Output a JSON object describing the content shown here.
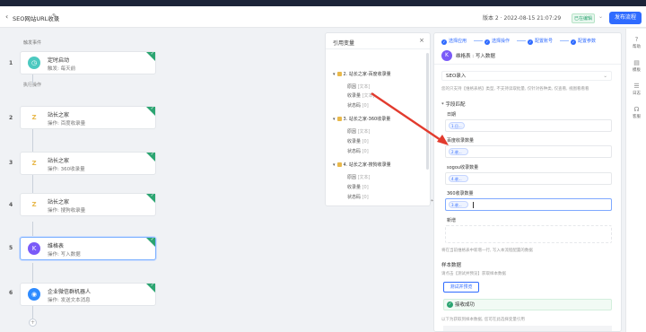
{
  "header": {
    "back_icon": "chevron-left-icon",
    "title": "SEO网站URL收录",
    "version": "版本 2 · 2022-08-15 21:07:29",
    "status_badge": "已在编辑",
    "publish_label": "发布流程"
  },
  "canvas": {
    "trigger_label": "触发事件",
    "action_label": "执行操作",
    "nodes": [
      {
        "num": "1",
        "title": "定时启动",
        "subtitle": "触发: 每天前",
        "icon": "clock-icon",
        "color": "#4cc9c0"
      },
      {
        "num": "2",
        "title": "站长之家",
        "subtitle": "操作: 百度收录量",
        "icon": "z-icon",
        "color": "#ffffff"
      },
      {
        "num": "3",
        "title": "站长之家",
        "subtitle": "操作: 360收录量",
        "icon": "z-icon",
        "color": "#ffffff"
      },
      {
        "num": "4",
        "title": "站长之家",
        "subtitle": "操作: 搜狗收录量",
        "icon": "z-icon",
        "color": "#ffffff"
      },
      {
        "num": "5",
        "title": "维格表",
        "subtitle": "操作: 写入数据",
        "icon": "vika-icon",
        "color": "#7a5af8"
      },
      {
        "num": "6",
        "title": "企业微信群机器人",
        "subtitle": "操作: 发送文本消息",
        "icon": "bot-icon",
        "color": "#2f8bff"
      }
    ],
    "add_label": "+"
  },
  "var_panel": {
    "title": "引用变量",
    "close": "×",
    "groups": [
      {
        "title": "2. 站长之家-百度收录量",
        "rows": [
          {
            "name": "原因",
            "type": "[文本]"
          },
          {
            "name": "收录量",
            "type": "[文本]"
          },
          {
            "name": "状态码",
            "type": "[0]"
          }
        ]
      },
      {
        "title": "3. 站长之家-360收录量",
        "rows": [
          {
            "name": "原因",
            "type": "[文本]"
          },
          {
            "name": "收录量",
            "type": "[0]"
          },
          {
            "name": "状态码",
            "type": "[0]"
          }
        ]
      },
      {
        "title": "4. 站长之家-搜狗收录量",
        "rows": [
          {
            "name": "原因",
            "type": "[文本]"
          },
          {
            "name": "收录量",
            "type": "[0]"
          },
          {
            "name": "状态码",
            "type": "[0]"
          }
        ]
      }
    ]
  },
  "right_panel": {
    "steps": [
      "选择应用",
      "选择操作",
      "配置账号",
      "配置参数"
    ],
    "app_title": "维格表 : 写入数据",
    "sheet_select": "SEO录入",
    "sheet_hint": "您的只支持【维格表格】类型, 不支持读取批量, 仅针对各种类, 仅查看, 视图看看看",
    "section_fields": "* 字段匹配",
    "fields": [
      {
        "label": "日期",
        "chip": "1.日..."
      },
      {
        "label": "百度收录数量",
        "chip": "2.收..."
      },
      {
        "label": "sogou收录数量",
        "chip": "4.收..."
      },
      {
        "label": "360收录数量",
        "chip": "3.收..."
      }
    ],
    "new_label": "新增",
    "append_hint": "将在当前维格表中新增一行, 写入本流程配置的数据",
    "sample_title": "样本数据",
    "sample_hint": "请点击【测试并预览】获取样本数据",
    "test_button": "测试并预览",
    "success_text": "接收成功",
    "footer_hint": "以下为获取到样本数据, 您可在此选择变量引用"
  },
  "rail": {
    "items": [
      {
        "label": "帮助",
        "icon": "help-icon"
      },
      {
        "label": "模板",
        "icon": "template-icon"
      },
      {
        "label": "日志",
        "icon": "log-icon"
      },
      {
        "label": "客服",
        "icon": "service-icon"
      }
    ]
  },
  "colors": {
    "accent": "#2f6bff",
    "success": "#2ba471",
    "arrow": "#e23b2e"
  }
}
